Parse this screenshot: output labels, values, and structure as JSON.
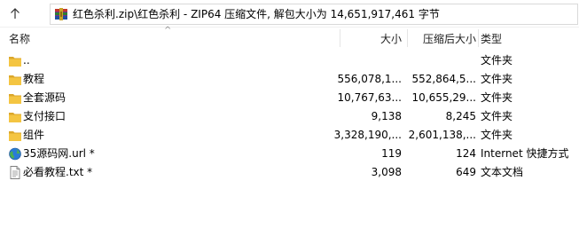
{
  "address": {
    "path": "红色杀利.zip\\红色杀利 - ZIP64 压缩文件, 解包大小为 14,651,917,461 字节"
  },
  "columns": {
    "name": "名称",
    "size": "大小",
    "packed": "压缩后大小",
    "type": "类型"
  },
  "rows": [
    {
      "name": "..",
      "size": "",
      "packed": "",
      "type": "文件夹",
      "icon": "folder-icon"
    },
    {
      "name": "教程",
      "size": "556,078,1...",
      "packed": "552,864,5...",
      "type": "文件夹",
      "icon": "folder-icon"
    },
    {
      "name": "全套源码",
      "size": "10,767,63...",
      "packed": "10,655,29...",
      "type": "文件夹",
      "icon": "folder-icon"
    },
    {
      "name": "支付接口",
      "size": "9,138",
      "packed": "8,245",
      "type": "文件夹",
      "icon": "folder-icon"
    },
    {
      "name": "组件",
      "size": "3,328,190,...",
      "packed": "2,601,138,...",
      "type": "文件夹",
      "icon": "folder-icon"
    },
    {
      "name": "35源码网.url *",
      "size": "119",
      "packed": "124",
      "type": "Internet 快捷方式",
      "icon": "internet-shortcut-icon"
    },
    {
      "name": "必看教程.txt *",
      "size": "3,098",
      "packed": "649",
      "type": "文本文档",
      "icon": "text-document-icon"
    }
  ],
  "colors": {
    "folder": "#f4c542",
    "folder_dark": "#dba72b",
    "header_text": "#1e1e1e"
  }
}
